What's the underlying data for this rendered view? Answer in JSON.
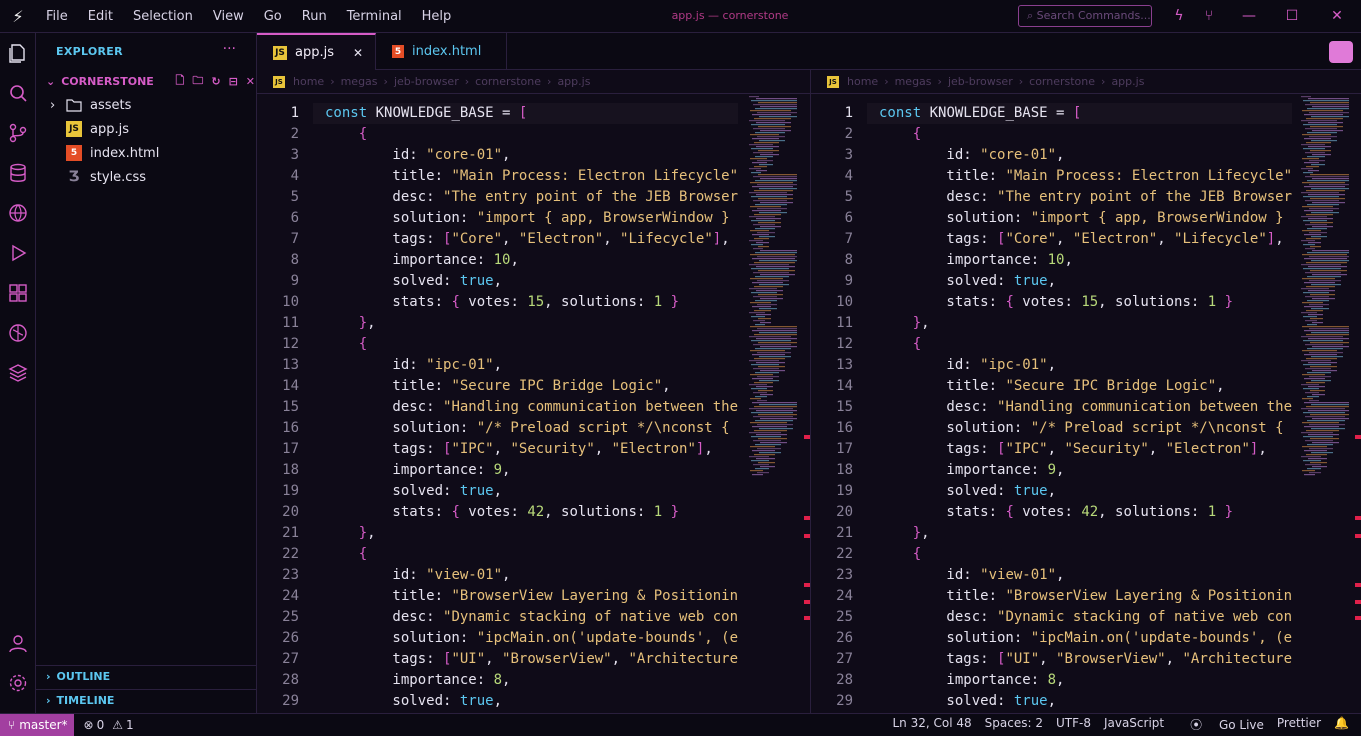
{
  "menu": [
    "File",
    "Edit",
    "Selection",
    "View",
    "Go",
    "Run",
    "Terminal",
    "Help"
  ],
  "window_title": "app.js — cornerstone",
  "search_commands_placeholder": "Search Commands...",
  "explorer": {
    "title": "EXPLORER",
    "workspace": "CORNERSTONE",
    "items": [
      {
        "name": "assets",
        "type": "folder-icon"
      },
      {
        "name": "app.js",
        "type": "js-file-icon"
      },
      {
        "name": "index.html",
        "type": "html-file-icon"
      },
      {
        "name": "style.css",
        "type": "css-file-icon"
      }
    ],
    "outline": "OUTLINE",
    "timeline": "TIMELINE"
  },
  "tabs": [
    {
      "label": "app.js",
      "active": true
    },
    {
      "label": "index.html",
      "active": false
    }
  ],
  "breadcrumb": [
    "home",
    "megas",
    "jeb-browser",
    "cornerstone",
    "app.js"
  ],
  "code_lines": [
    "const KNOWLEDGE_BASE = [",
    "    {",
    "        id: \"core-01\",",
    "        title: \"Main Process: Electron Lifecycle\",",
    "        desc: \"The entry point of the JEB Browser",
    "        solution: \"import { app, BrowserWindow } f",
    "        tags: [\"Core\", \"Electron\", \"Lifecycle\"],",
    "        importance: 10,",
    "        solved: true,",
    "        stats: { votes: 15, solutions: 1 }",
    "    },",
    "    {",
    "        id: \"ipc-01\",",
    "        title: \"Secure IPC Bridge Logic\",",
    "        desc: \"Handling communication between the",
    "        solution: \"/* Preload script */\\nconst { c",
    "        tags: [\"IPC\", \"Security\", \"Electron\"],",
    "        importance: 9,",
    "        solved: true,",
    "        stats: { votes: 42, solutions: 1 }",
    "    },",
    "    {",
    "        id: \"view-01\",",
    "        title: \"BrowserView Layering & Positioning",
    "        desc: \"Dynamic stacking of native web cont",
    "        solution: \"ipcMain.on('update-bounds', (ev",
    "        tags: [\"UI\", \"BrowserView\", \"Architecture\"",
    "        importance: 8,",
    "        solved: true,"
  ],
  "line_numbers": [
    "1",
    "2",
    "3",
    "4",
    "5",
    "6",
    "7",
    "8",
    "9",
    "10",
    "11",
    "12",
    "13",
    "14",
    "15",
    "16",
    "17",
    "18",
    "19",
    "20",
    "21",
    "22",
    "23",
    "24",
    "25",
    "26",
    "27",
    "28",
    "29"
  ],
  "status": {
    "branch": "master*",
    "errors": "0",
    "warnings": "1",
    "position": "Ln 32, Col 48",
    "spaces": "Spaces: 2",
    "encoding": "UTF-8",
    "language": "JavaScript",
    "golive": "Go Live",
    "prettier": "Prettier"
  },
  "colors": {
    "accent": "#d65cc7",
    "keyword": "#5cc7f0",
    "string": "#e6c07b",
    "number": "#b8d97a",
    "bg": "#0f0b18"
  }
}
